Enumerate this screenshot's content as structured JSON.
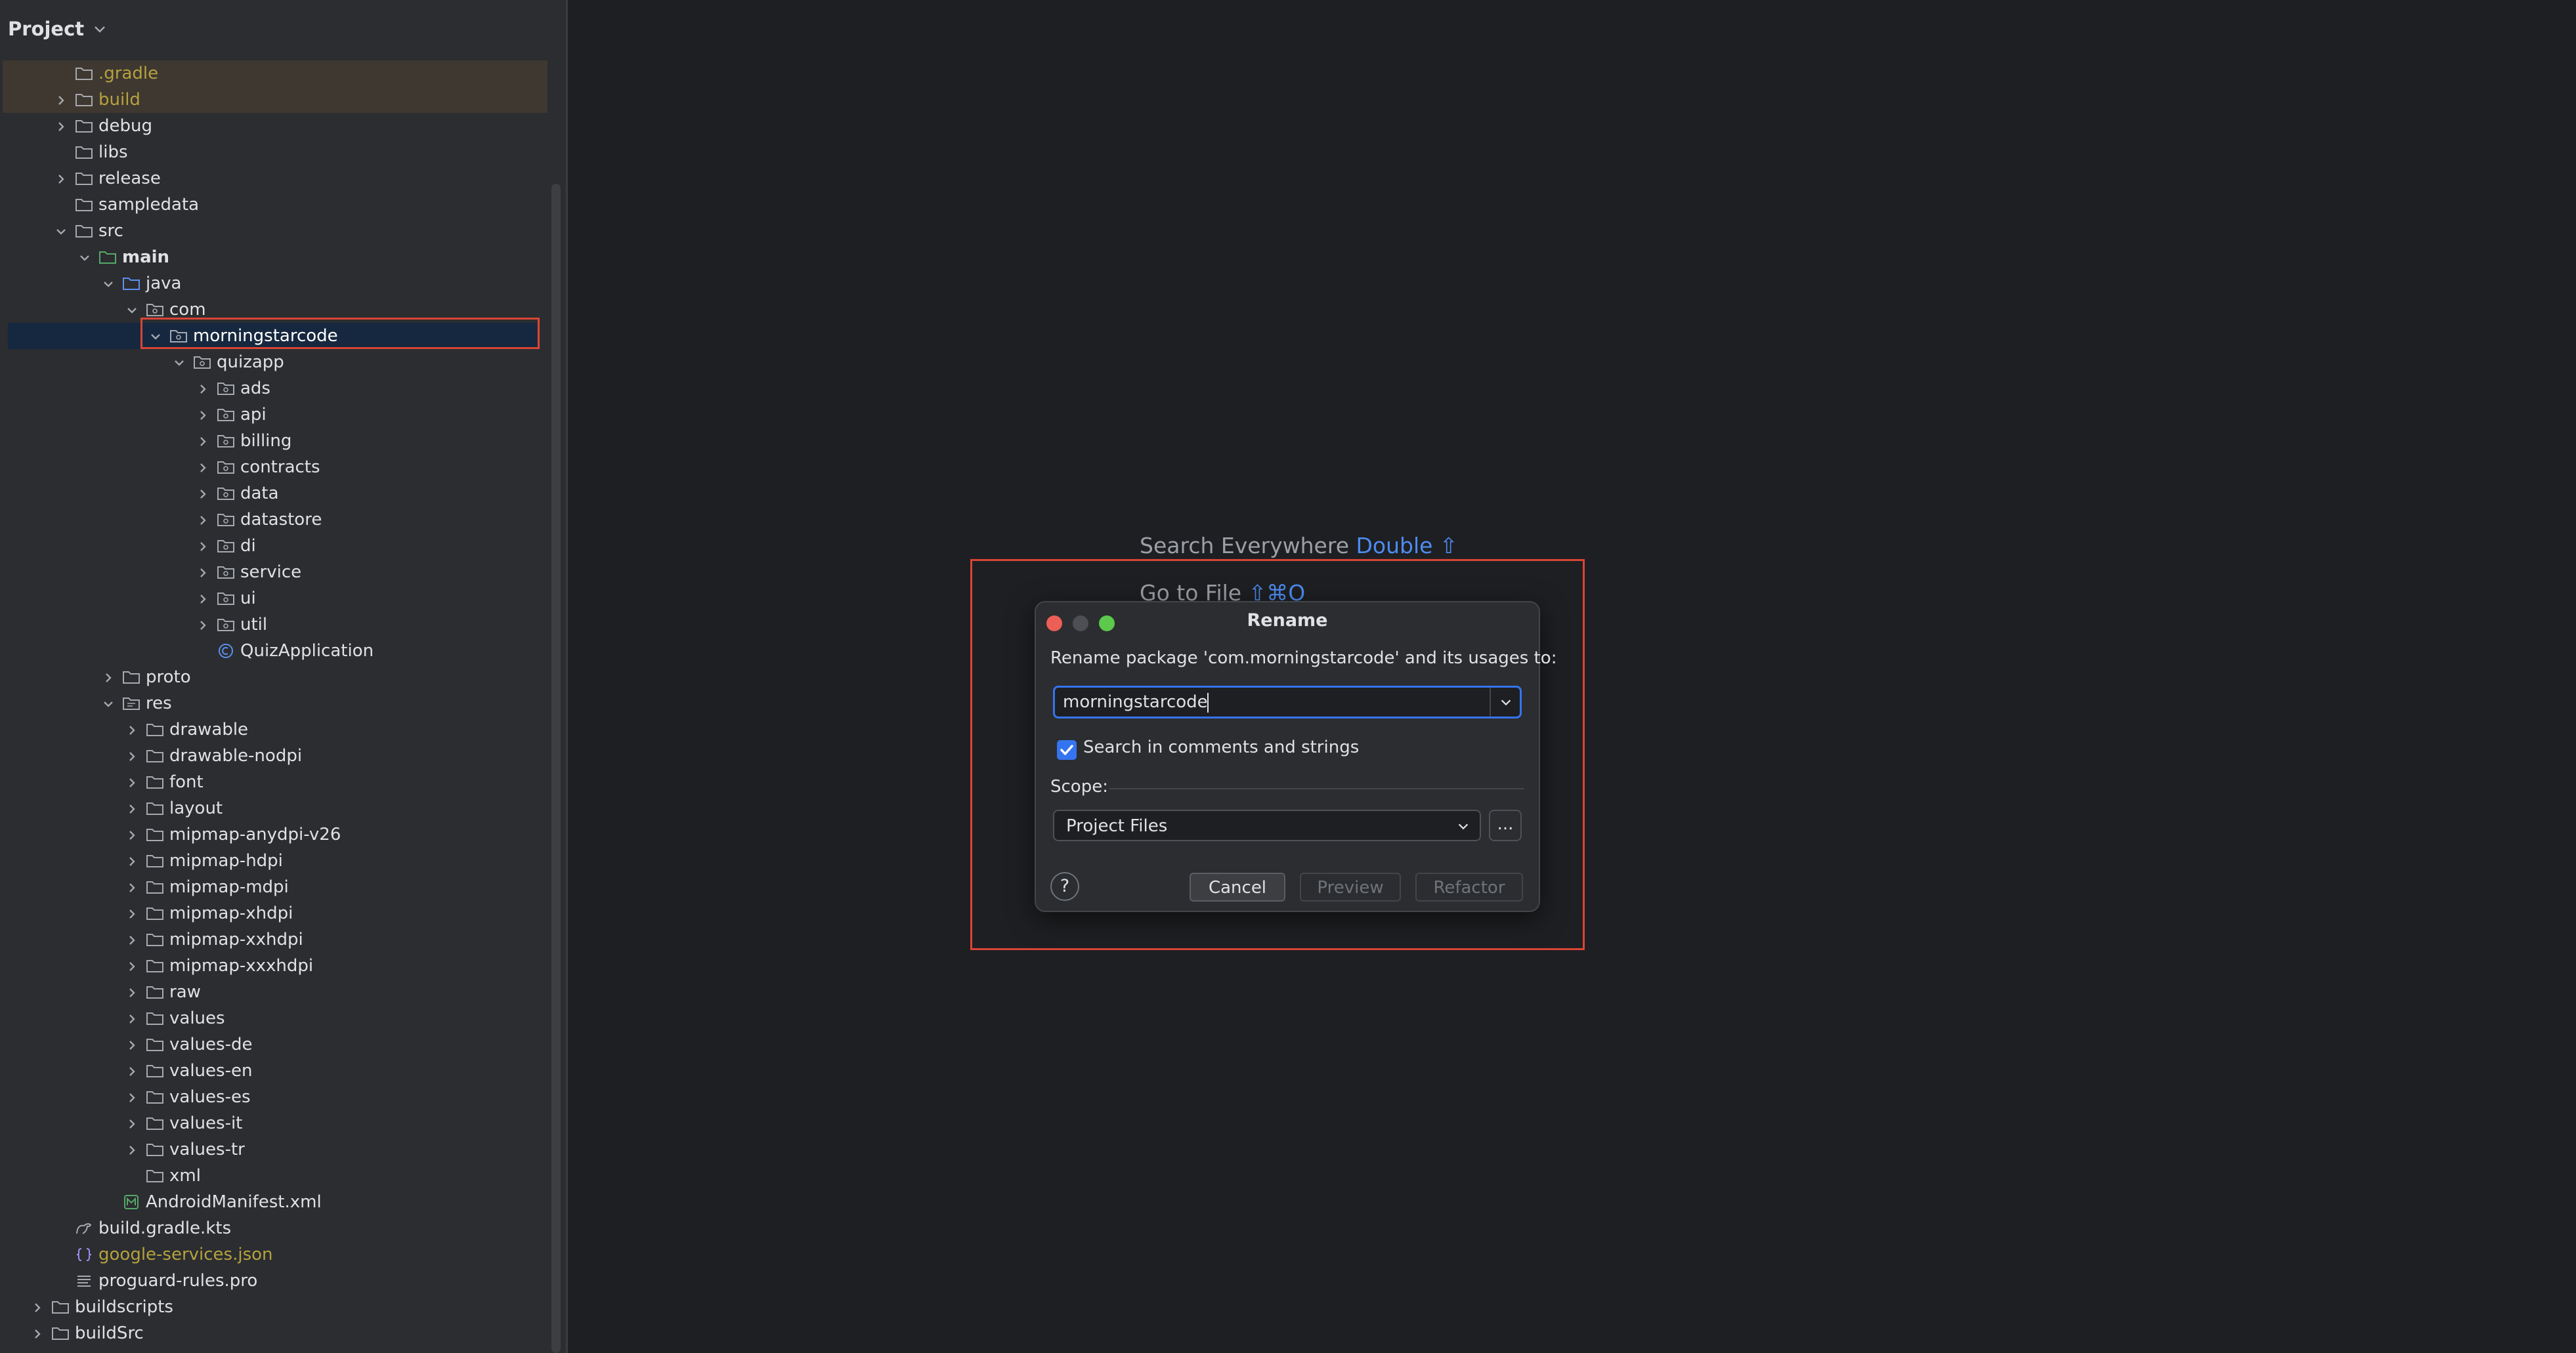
{
  "sidebar": {
    "title": "Project",
    "tree": [
      {
        "label": ".gradle",
        "indent": 2,
        "chevron": "none",
        "icon": "folder-icon",
        "style": "ignored"
      },
      {
        "label": "build",
        "indent": 2,
        "chevron": "right",
        "icon": "folder-icon",
        "style": "ignored"
      },
      {
        "label": "debug",
        "indent": 2,
        "chevron": "right",
        "icon": "folder-icon"
      },
      {
        "label": "libs",
        "indent": 2,
        "chevron": "none",
        "icon": "folder-icon"
      },
      {
        "label": "release",
        "indent": 2,
        "chevron": "right",
        "icon": "folder-icon"
      },
      {
        "label": "sampledata",
        "indent": 2,
        "chevron": "none",
        "icon": "folder-icon"
      },
      {
        "label": "src",
        "indent": 2,
        "chevron": "down",
        "icon": "folder-icon"
      },
      {
        "label": "main",
        "indent": 3,
        "chevron": "down",
        "icon": "source-root-folder-icon",
        "style": "bold"
      },
      {
        "label": "java",
        "indent": 4,
        "chevron": "down",
        "icon": "source-folder-icon"
      },
      {
        "label": "com",
        "indent": 5,
        "chevron": "down",
        "icon": "package-icon"
      },
      {
        "label": "morningstarcode",
        "indent": 6,
        "chevron": "down",
        "icon": "package-icon",
        "style": "selected"
      },
      {
        "label": "quizapp",
        "indent": 7,
        "chevron": "down",
        "icon": "package-icon"
      },
      {
        "label": "ads",
        "indent": 8,
        "chevron": "right",
        "icon": "package-icon"
      },
      {
        "label": "api",
        "indent": 8,
        "chevron": "right",
        "icon": "package-icon"
      },
      {
        "label": "billing",
        "indent": 8,
        "chevron": "right",
        "icon": "package-icon"
      },
      {
        "label": "contracts",
        "indent": 8,
        "chevron": "right",
        "icon": "package-icon"
      },
      {
        "label": "data",
        "indent": 8,
        "chevron": "right",
        "icon": "package-icon"
      },
      {
        "label": "datastore",
        "indent": 8,
        "chevron": "right",
        "icon": "package-icon"
      },
      {
        "label": "di",
        "indent": 8,
        "chevron": "right",
        "icon": "package-icon"
      },
      {
        "label": "service",
        "indent": 8,
        "chevron": "right",
        "icon": "package-icon"
      },
      {
        "label": "ui",
        "indent": 8,
        "chevron": "right",
        "icon": "package-icon"
      },
      {
        "label": "util",
        "indent": 8,
        "chevron": "right",
        "icon": "package-icon"
      },
      {
        "label": "QuizApplication",
        "indent": 8,
        "chevron": "none",
        "icon": "kotlin-class-icon"
      },
      {
        "label": "proto",
        "indent": 4,
        "chevron": "right",
        "icon": "folder-icon"
      },
      {
        "label": "res",
        "indent": 4,
        "chevron": "down",
        "icon": "resources-folder-icon"
      },
      {
        "label": "drawable",
        "indent": 5,
        "chevron": "right",
        "icon": "folder-icon"
      },
      {
        "label": "drawable-nodpi",
        "indent": 5,
        "chevron": "right",
        "icon": "folder-icon"
      },
      {
        "label": "font",
        "indent": 5,
        "chevron": "right",
        "icon": "folder-icon"
      },
      {
        "label": "layout",
        "indent": 5,
        "chevron": "right",
        "icon": "folder-icon"
      },
      {
        "label": "mipmap-anydpi-v26",
        "indent": 5,
        "chevron": "right",
        "icon": "folder-icon"
      },
      {
        "label": "mipmap-hdpi",
        "indent": 5,
        "chevron": "right",
        "icon": "folder-icon"
      },
      {
        "label": "mipmap-mdpi",
        "indent": 5,
        "chevron": "right",
        "icon": "folder-icon"
      },
      {
        "label": "mipmap-xhdpi",
        "indent": 5,
        "chevron": "right",
        "icon": "folder-icon"
      },
      {
        "label": "mipmap-xxhdpi",
        "indent": 5,
        "chevron": "right",
        "icon": "folder-icon"
      },
      {
        "label": "mipmap-xxxhdpi",
        "indent": 5,
        "chevron": "right",
        "icon": "folder-icon"
      },
      {
        "label": "raw",
        "indent": 5,
        "chevron": "right",
        "icon": "folder-icon"
      },
      {
        "label": "values",
        "indent": 5,
        "chevron": "right",
        "icon": "folder-icon"
      },
      {
        "label": "values-de",
        "indent": 5,
        "chevron": "right",
        "icon": "folder-icon"
      },
      {
        "label": "values-en",
        "indent": 5,
        "chevron": "right",
        "icon": "folder-icon"
      },
      {
        "label": "values-es",
        "indent": 5,
        "chevron": "right",
        "icon": "folder-icon"
      },
      {
        "label": "values-it",
        "indent": 5,
        "chevron": "right",
        "icon": "folder-icon"
      },
      {
        "label": "values-tr",
        "indent": 5,
        "chevron": "right",
        "icon": "folder-icon"
      },
      {
        "label": "xml",
        "indent": 5,
        "chevron": "none",
        "icon": "folder-icon"
      },
      {
        "label": "AndroidManifest.xml",
        "indent": 4,
        "chevron": "none",
        "icon": "manifest-icon"
      },
      {
        "label": "build.gradle.kts",
        "indent": 2,
        "chevron": "none",
        "icon": "gradle-icon"
      },
      {
        "label": "google-services.json",
        "indent": 2,
        "chevron": "none",
        "icon": "json-icon",
        "style": "ignored-text"
      },
      {
        "label": "proguard-rules.pro",
        "indent": 2,
        "chevron": "none",
        "icon": "text-file-icon"
      },
      {
        "label": "buildscripts",
        "indent": 1,
        "chevron": "right",
        "icon": "folder-icon"
      },
      {
        "label": "buildSrc",
        "indent": 1,
        "chevron": "right",
        "icon": "folder-icon"
      }
    ]
  },
  "editor_hints": {
    "search_everywhere_label": "Search Everywhere",
    "search_everywhere_key": "Double ⇧",
    "go_to_file_label": "Go to File",
    "go_to_file_key": "⇧⌘O"
  },
  "dialog": {
    "title": "Rename",
    "prompt": "Rename package 'com.morningstarcode' and its usages to:",
    "name_value": "morningstarcode",
    "search_comments_label": "Search in comments and strings",
    "search_comments_checked": true,
    "scope_label": "Scope:",
    "scope_value": "Project Files",
    "more_label": "...",
    "help_label": "?",
    "cancel_label": "Cancel",
    "preview_label": "Preview",
    "refactor_label": "Refactor"
  },
  "colors": {
    "sidebar_bg": "#2b2d30",
    "editor_bg": "#1e1f22",
    "selection": "#16283f",
    "accent_blue": "#3574f0",
    "highlight_red": "#d94536",
    "ignored_text": "#b5a13f",
    "folder_gray": "#a6a9af",
    "source_blue": "#5d8ff0",
    "source_root_green": "#56a86a"
  }
}
